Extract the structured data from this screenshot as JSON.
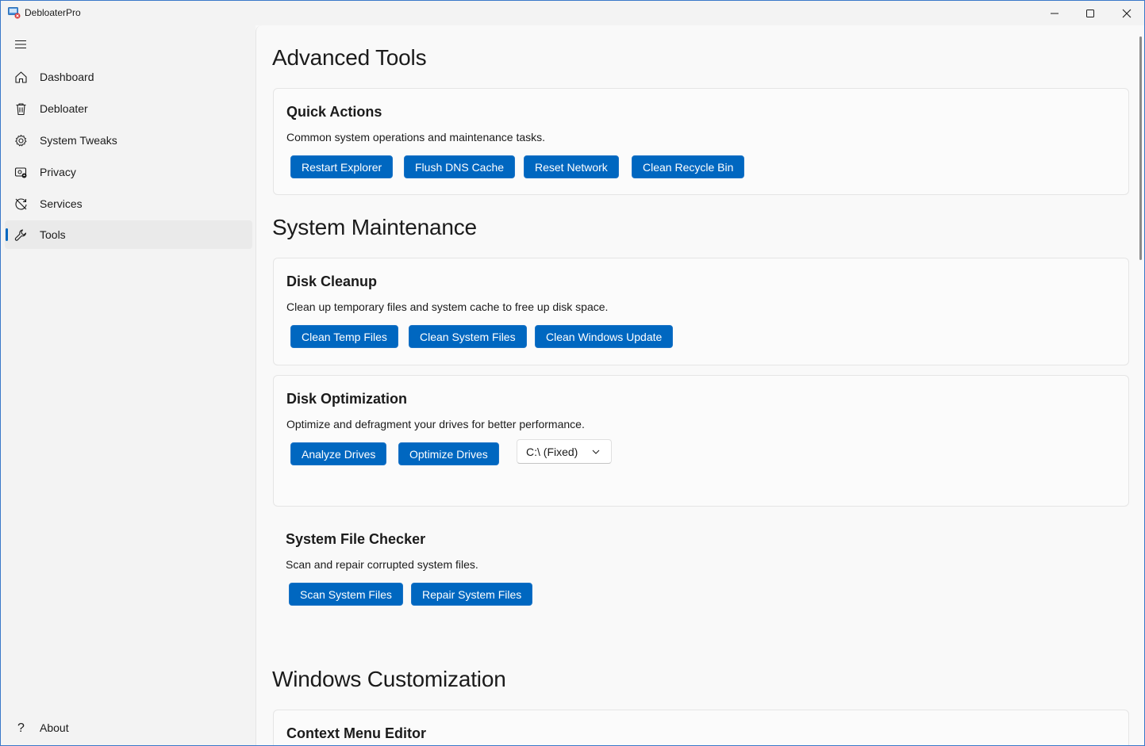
{
  "window": {
    "title": "DebloaterPro"
  },
  "sidebar": {
    "items": [
      {
        "label": "Dashboard",
        "icon": "home-icon"
      },
      {
        "label": "Debloater",
        "icon": "trash-icon"
      },
      {
        "label": "System Tweaks",
        "icon": "gear-icon"
      },
      {
        "label": "Privacy",
        "icon": "privacy-icon"
      },
      {
        "label": "Services",
        "icon": "services-icon"
      },
      {
        "label": "Tools",
        "icon": "wrench-icon",
        "selected": true
      }
    ],
    "footer": {
      "label": "About",
      "icon": "question-icon"
    }
  },
  "page": {
    "sections": [
      {
        "title": "Advanced Tools",
        "cards": [
          {
            "title": "Quick Actions",
            "description": "Common system operations and maintenance tasks.",
            "buttons": [
              "Restart Explorer",
              "Flush DNS Cache",
              "Reset Network",
              "Clean Recycle Bin"
            ]
          }
        ]
      },
      {
        "title": "System Maintenance",
        "cards": [
          {
            "title": "Disk Cleanup",
            "description": "Clean up temporary files and system cache to free up disk space.",
            "buttons": [
              "Clean Temp Files",
              "Clean System Files",
              "Clean Windows Update"
            ]
          },
          {
            "title": "Disk Optimization",
            "description": "Optimize and defragment your drives for better performance.",
            "buttons": [
              "Analyze Drives",
              "Optimize Drives"
            ],
            "dropdown": {
              "selected": "C:\\ (Fixed)"
            }
          },
          {
            "title": "System File Checker",
            "description": "Scan and repair corrupted system files.",
            "buttons": [
              "Scan System Files",
              "Repair System Files"
            ]
          }
        ]
      },
      {
        "title": "Windows Customization",
        "cards": [
          {
            "title": "Context Menu Editor"
          }
        ]
      }
    ]
  },
  "colors": {
    "accent": "#0067c0",
    "sidebar_bg": "#f3f3f3",
    "content_bg": "#f9f9f9",
    "card_border": "#e5e5e5"
  }
}
